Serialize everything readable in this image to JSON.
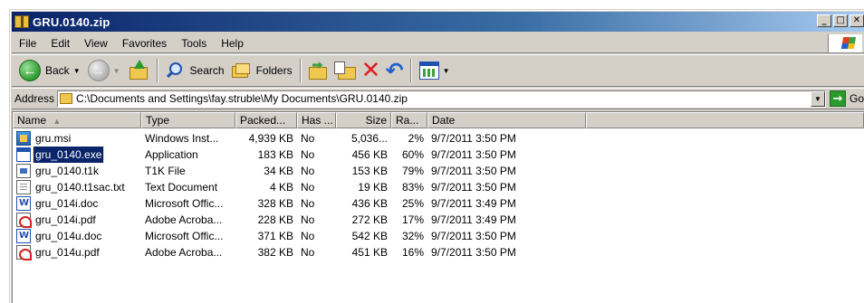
{
  "window": {
    "title": "GRU.0140.zip"
  },
  "title_buttons": {
    "minimize": "_",
    "maximize": "□",
    "close": "✕"
  },
  "menu": [
    "File",
    "Edit",
    "View",
    "Favorites",
    "Tools",
    "Help"
  ],
  "toolbar": {
    "back_label": "Back",
    "search_label": "Search",
    "folders_label": "Folders"
  },
  "address": {
    "label": "Address",
    "path": "C:\\Documents and Settings\\fay.struble\\My Documents\\GRU.0140.zip",
    "go_label": "Go"
  },
  "columns": [
    {
      "key": "name",
      "label": "Name"
    },
    {
      "key": "type",
      "label": "Type"
    },
    {
      "key": "packed",
      "label": "Packed..."
    },
    {
      "key": "has",
      "label": "Has ..."
    },
    {
      "key": "size",
      "label": "Size"
    },
    {
      "key": "ratio",
      "label": "Ra..."
    },
    {
      "key": "date",
      "label": "Date"
    }
  ],
  "files": [
    {
      "name": "gru.msi",
      "icon": "msi-icon",
      "type": "Windows Inst...",
      "packed": "4,939 KB",
      "has": "No",
      "size": "5,036...",
      "ratio": "2%",
      "date": "9/7/2011 3:50 PM",
      "selected": false
    },
    {
      "name": "gru_0140.exe",
      "icon": "exe-icon",
      "type": "Application",
      "packed": "183 KB",
      "has": "No",
      "size": "456 KB",
      "ratio": "60%",
      "date": "9/7/2011 3:50 PM",
      "selected": true
    },
    {
      "name": "gru_0140.t1k",
      "icon": "t1k-icon",
      "type": "T1K File",
      "packed": "34 KB",
      "has": "No",
      "size": "153 KB",
      "ratio": "79%",
      "date": "9/7/2011 3:50 PM",
      "selected": false
    },
    {
      "name": "gru_0140.t1sac.txt",
      "icon": "txt-icon",
      "type": "Text Document",
      "packed": "4 KB",
      "has": "No",
      "size": "19 KB",
      "ratio": "83%",
      "date": "9/7/2011 3:50 PM",
      "selected": false
    },
    {
      "name": "gru_014i.doc",
      "icon": "doc-icon",
      "type": "Microsoft Offic...",
      "packed": "328 KB",
      "has": "No",
      "size": "436 KB",
      "ratio": "25%",
      "date": "9/7/2011 3:49 PM",
      "selected": false
    },
    {
      "name": "gru_014i.pdf",
      "icon": "pdf-icon",
      "type": "Adobe Acroba...",
      "packed": "228 KB",
      "has": "No",
      "size": "272 KB",
      "ratio": "17%",
      "date": "9/7/2011 3:49 PM",
      "selected": false
    },
    {
      "name": "gru_014u.doc",
      "icon": "doc-icon",
      "type": "Microsoft Offic...",
      "packed": "371 KB",
      "has": "No",
      "size": "542 KB",
      "ratio": "32%",
      "date": "9/7/2011 3:50 PM",
      "selected": false
    },
    {
      "name": "gru_014u.pdf",
      "icon": "pdf-icon",
      "type": "Adobe Acroba...",
      "packed": "382 KB",
      "has": "No",
      "size": "451 KB",
      "ratio": "16%",
      "date": "9/7/2011 3:50 PM",
      "selected": false
    }
  ]
}
